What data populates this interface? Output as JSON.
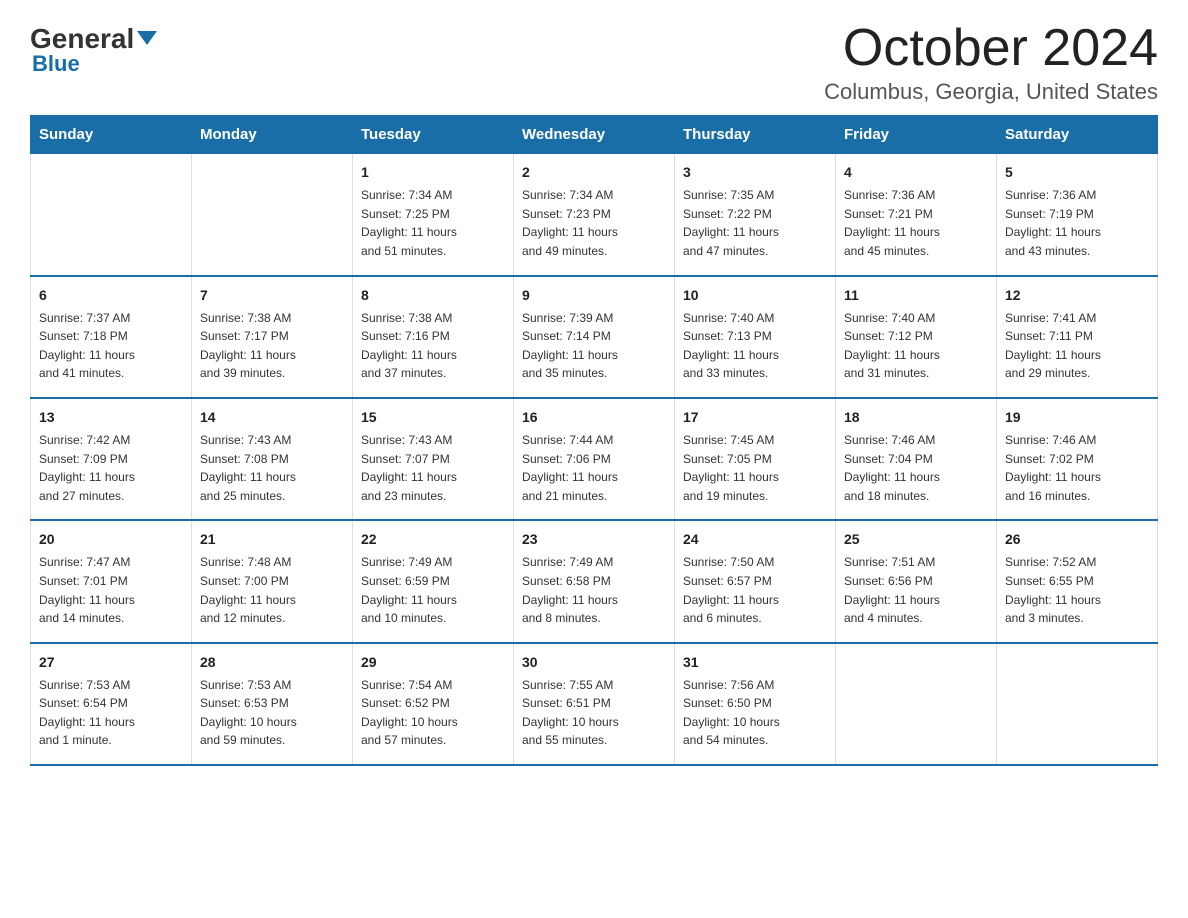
{
  "header": {
    "logo_general": "General",
    "logo_blue": "Blue",
    "month_title": "October 2024",
    "location": "Columbus, Georgia, United States"
  },
  "weekdays": [
    "Sunday",
    "Monday",
    "Tuesday",
    "Wednesday",
    "Thursday",
    "Friday",
    "Saturday"
  ],
  "weeks": [
    [
      {
        "day": "",
        "info": ""
      },
      {
        "day": "",
        "info": ""
      },
      {
        "day": "1",
        "info": "Sunrise: 7:34 AM\nSunset: 7:25 PM\nDaylight: 11 hours\nand 51 minutes."
      },
      {
        "day": "2",
        "info": "Sunrise: 7:34 AM\nSunset: 7:23 PM\nDaylight: 11 hours\nand 49 minutes."
      },
      {
        "day": "3",
        "info": "Sunrise: 7:35 AM\nSunset: 7:22 PM\nDaylight: 11 hours\nand 47 minutes."
      },
      {
        "day": "4",
        "info": "Sunrise: 7:36 AM\nSunset: 7:21 PM\nDaylight: 11 hours\nand 45 minutes."
      },
      {
        "day": "5",
        "info": "Sunrise: 7:36 AM\nSunset: 7:19 PM\nDaylight: 11 hours\nand 43 minutes."
      }
    ],
    [
      {
        "day": "6",
        "info": "Sunrise: 7:37 AM\nSunset: 7:18 PM\nDaylight: 11 hours\nand 41 minutes."
      },
      {
        "day": "7",
        "info": "Sunrise: 7:38 AM\nSunset: 7:17 PM\nDaylight: 11 hours\nand 39 minutes."
      },
      {
        "day": "8",
        "info": "Sunrise: 7:38 AM\nSunset: 7:16 PM\nDaylight: 11 hours\nand 37 minutes."
      },
      {
        "day": "9",
        "info": "Sunrise: 7:39 AM\nSunset: 7:14 PM\nDaylight: 11 hours\nand 35 minutes."
      },
      {
        "day": "10",
        "info": "Sunrise: 7:40 AM\nSunset: 7:13 PM\nDaylight: 11 hours\nand 33 minutes."
      },
      {
        "day": "11",
        "info": "Sunrise: 7:40 AM\nSunset: 7:12 PM\nDaylight: 11 hours\nand 31 minutes."
      },
      {
        "day": "12",
        "info": "Sunrise: 7:41 AM\nSunset: 7:11 PM\nDaylight: 11 hours\nand 29 minutes."
      }
    ],
    [
      {
        "day": "13",
        "info": "Sunrise: 7:42 AM\nSunset: 7:09 PM\nDaylight: 11 hours\nand 27 minutes."
      },
      {
        "day": "14",
        "info": "Sunrise: 7:43 AM\nSunset: 7:08 PM\nDaylight: 11 hours\nand 25 minutes."
      },
      {
        "day": "15",
        "info": "Sunrise: 7:43 AM\nSunset: 7:07 PM\nDaylight: 11 hours\nand 23 minutes."
      },
      {
        "day": "16",
        "info": "Sunrise: 7:44 AM\nSunset: 7:06 PM\nDaylight: 11 hours\nand 21 minutes."
      },
      {
        "day": "17",
        "info": "Sunrise: 7:45 AM\nSunset: 7:05 PM\nDaylight: 11 hours\nand 19 minutes."
      },
      {
        "day": "18",
        "info": "Sunrise: 7:46 AM\nSunset: 7:04 PM\nDaylight: 11 hours\nand 18 minutes."
      },
      {
        "day": "19",
        "info": "Sunrise: 7:46 AM\nSunset: 7:02 PM\nDaylight: 11 hours\nand 16 minutes."
      }
    ],
    [
      {
        "day": "20",
        "info": "Sunrise: 7:47 AM\nSunset: 7:01 PM\nDaylight: 11 hours\nand 14 minutes."
      },
      {
        "day": "21",
        "info": "Sunrise: 7:48 AM\nSunset: 7:00 PM\nDaylight: 11 hours\nand 12 minutes."
      },
      {
        "day": "22",
        "info": "Sunrise: 7:49 AM\nSunset: 6:59 PM\nDaylight: 11 hours\nand 10 minutes."
      },
      {
        "day": "23",
        "info": "Sunrise: 7:49 AM\nSunset: 6:58 PM\nDaylight: 11 hours\nand 8 minutes."
      },
      {
        "day": "24",
        "info": "Sunrise: 7:50 AM\nSunset: 6:57 PM\nDaylight: 11 hours\nand 6 minutes."
      },
      {
        "day": "25",
        "info": "Sunrise: 7:51 AM\nSunset: 6:56 PM\nDaylight: 11 hours\nand 4 minutes."
      },
      {
        "day": "26",
        "info": "Sunrise: 7:52 AM\nSunset: 6:55 PM\nDaylight: 11 hours\nand 3 minutes."
      }
    ],
    [
      {
        "day": "27",
        "info": "Sunrise: 7:53 AM\nSunset: 6:54 PM\nDaylight: 11 hours\nand 1 minute."
      },
      {
        "day": "28",
        "info": "Sunrise: 7:53 AM\nSunset: 6:53 PM\nDaylight: 10 hours\nand 59 minutes."
      },
      {
        "day": "29",
        "info": "Sunrise: 7:54 AM\nSunset: 6:52 PM\nDaylight: 10 hours\nand 57 minutes."
      },
      {
        "day": "30",
        "info": "Sunrise: 7:55 AM\nSunset: 6:51 PM\nDaylight: 10 hours\nand 55 minutes."
      },
      {
        "day": "31",
        "info": "Sunrise: 7:56 AM\nSunset: 6:50 PM\nDaylight: 10 hours\nand 54 minutes."
      },
      {
        "day": "",
        "info": ""
      },
      {
        "day": "",
        "info": ""
      }
    ]
  ]
}
